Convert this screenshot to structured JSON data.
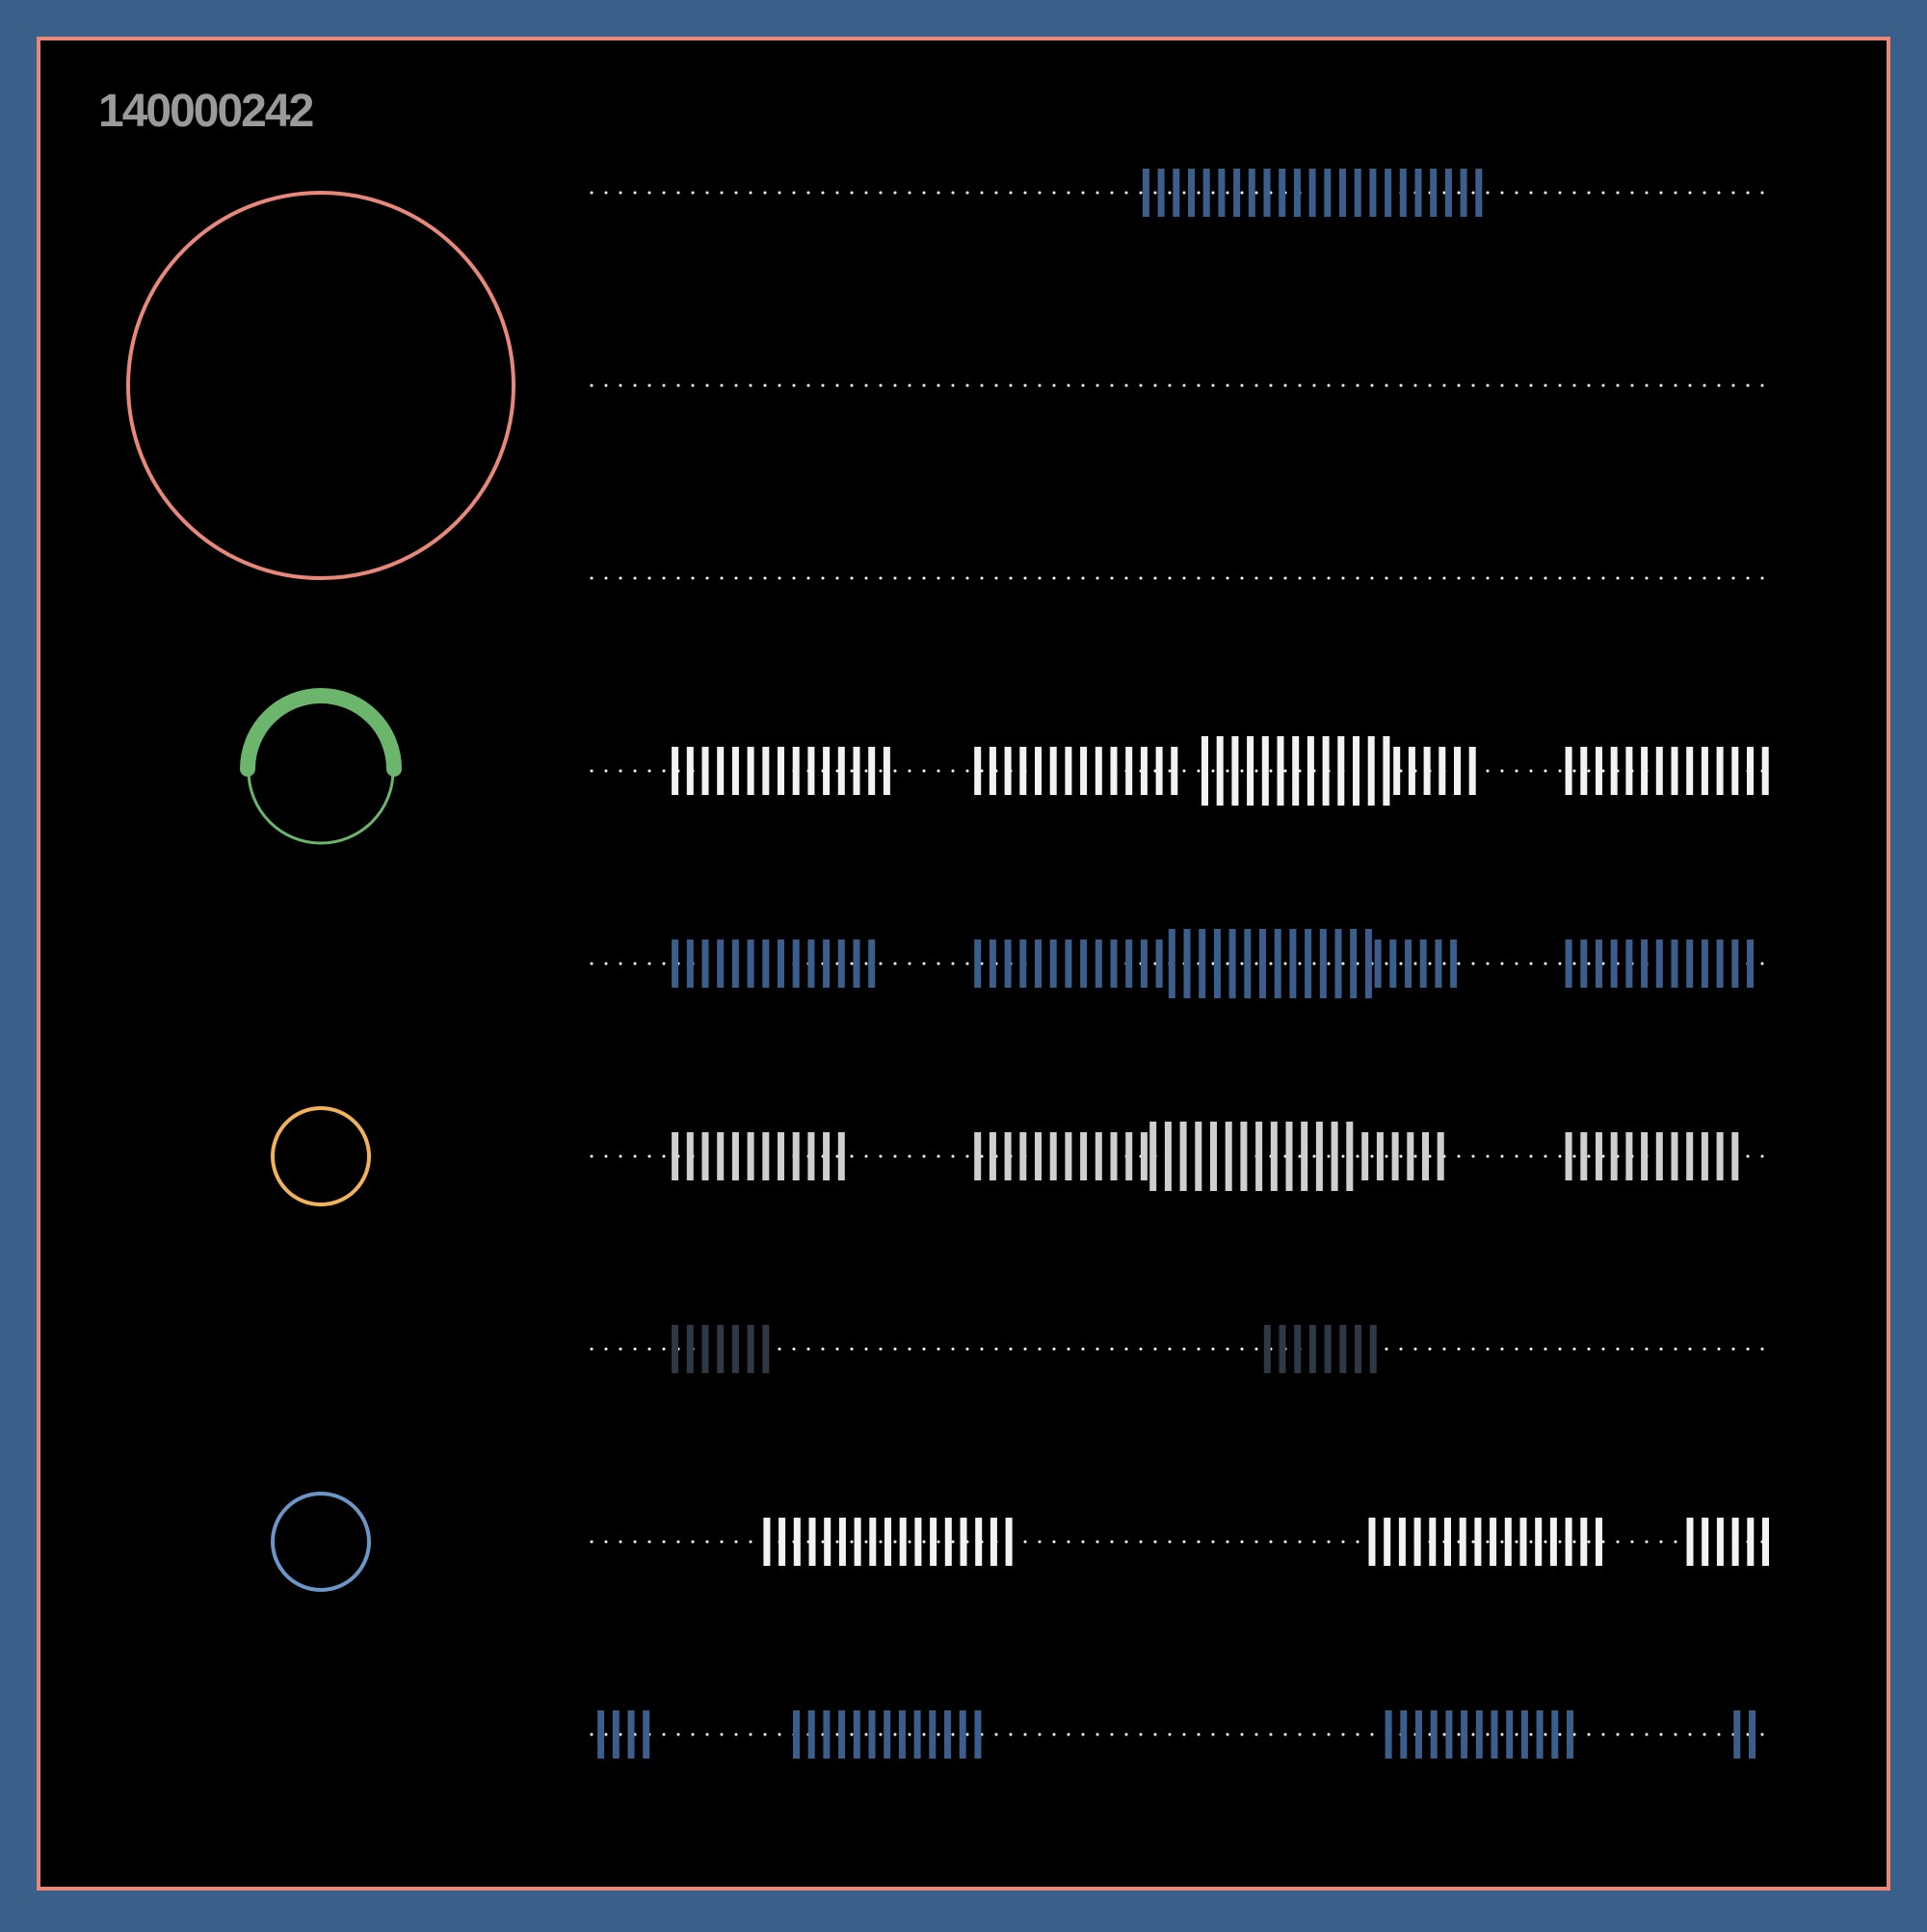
{
  "header": {
    "id_label": "140000242"
  },
  "colors": {
    "background": "#3a5f89",
    "panel": "#000000",
    "frame": "#e8887a",
    "label": "#9a9a9a",
    "dots": "#ffffff",
    "blue": "#3c5e8c",
    "white": "#f2f2f2",
    "light_gray": "#cfcfcf",
    "dark_gray": "#2f3845",
    "green": "#6cb56c",
    "orange": "#f2b25c",
    "light_blue": "#6b96c8"
  },
  "indicators": [
    {
      "name": "large-ring",
      "color": "#e8887a",
      "type": "ring"
    },
    {
      "name": "gauge-ring",
      "color": "#6cb56c",
      "type": "gauge",
      "level": 0.5
    },
    {
      "name": "small-ring-orange",
      "color": "#f2b25c",
      "type": "ring"
    },
    {
      "name": "small-ring-blue",
      "color": "#6b96c8",
      "type": "ring"
    }
  ],
  "tracks": [
    {
      "color": "#3c5e8c",
      "segments": [
        [
          0.468,
          0.758,
          "normal"
        ]
      ]
    },
    {
      "color": "#ffffff",
      "segments": []
    },
    {
      "color": "#ffffff",
      "segments": []
    },
    {
      "color": "#f2f2f2",
      "segments": [
        [
          0.068,
          0.255,
          "normal"
        ],
        [
          0.325,
          0.5,
          "normal"
        ],
        [
          0.518,
          0.681,
          "tall"
        ],
        [
          0.681,
          0.758,
          "normal"
        ],
        [
          0.827,
          1.0,
          "normal"
        ]
      ]
    },
    {
      "color": "#3c5e8c",
      "segments": [
        [
          0.068,
          0.242,
          "normal"
        ],
        [
          0.325,
          0.49,
          "normal"
        ],
        [
          0.49,
          0.665,
          "tall"
        ],
        [
          0.665,
          0.745,
          "normal"
        ],
        [
          0.827,
          0.987,
          "normal"
        ]
      ]
    },
    {
      "color": "#cfcfcf",
      "segments": [
        [
          0.068,
          0.218,
          "normal"
        ],
        [
          0.325,
          0.474,
          "normal"
        ],
        [
          0.474,
          0.654,
          "tall"
        ],
        [
          0.654,
          0.732,
          "normal"
        ],
        [
          0.827,
          0.974,
          "normal"
        ]
      ]
    },
    {
      "color": "#2f3845",
      "segments": [
        [
          0.068,
          0.153,
          "normal"
        ],
        [
          0.571,
          0.669,
          "normal"
        ]
      ]
    },
    {
      "color": "#f2f2f2",
      "segments": [
        [
          0.146,
          0.358,
          "normal"
        ],
        [
          0.66,
          0.861,
          "normal"
        ],
        [
          0.93,
          1.0,
          "normal"
        ]
      ]
    },
    {
      "color": "#3c5e8c",
      "segments": [
        [
          0.005,
          0.05,
          "normal"
        ],
        [
          0.171,
          0.333,
          "normal"
        ],
        [
          0.674,
          0.835,
          "normal"
        ],
        [
          0.97,
          1.0,
          "normal"
        ]
      ]
    }
  ]
}
